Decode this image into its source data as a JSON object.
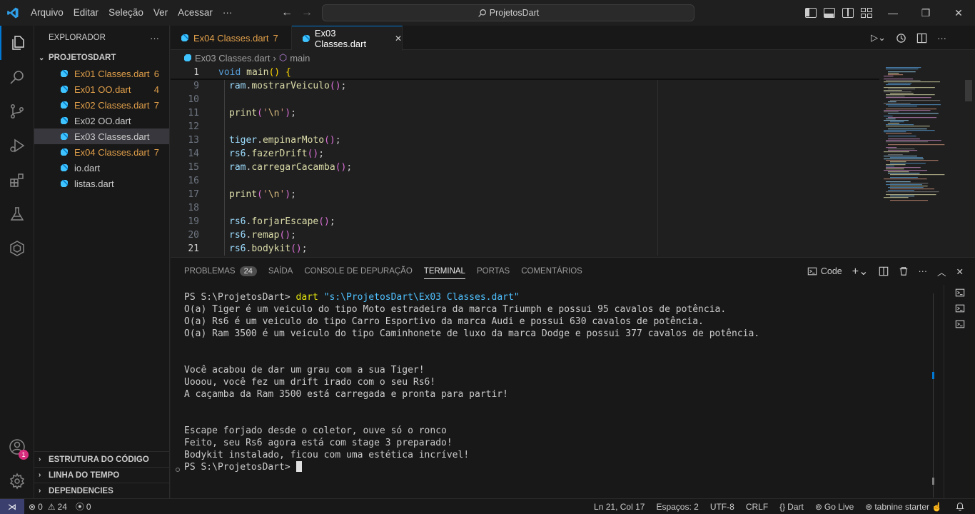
{
  "menu": [
    "Arquivo",
    "Editar",
    "Seleção",
    "Ver",
    "Acessar",
    "···"
  ],
  "command_center": "ProjetosDart",
  "sidebar": {
    "title": "EXPLORADOR",
    "more": "···",
    "project": "PROJETOSDART",
    "files": [
      {
        "name": "Ex01 Classes.dart",
        "count": "6",
        "modified": true
      },
      {
        "name": "Ex01 OO.dart",
        "count": "4",
        "modified": true
      },
      {
        "name": "Ex02 Classes.dart",
        "count": "7",
        "modified": true
      },
      {
        "name": "Ex02 OO.dart",
        "count": "",
        "modified": false
      },
      {
        "name": "Ex03 Classes.dart",
        "count": "",
        "modified": false,
        "selected": true
      },
      {
        "name": "Ex04 Classes.dart",
        "count": "7",
        "modified": true
      },
      {
        "name": "io.dart",
        "count": "",
        "modified": false
      },
      {
        "name": "listas.dart",
        "count": "",
        "modified": false
      }
    ],
    "bottom_sections": [
      "ESTRUTURA DO CÓDIGO",
      "LINHA DO TEMPO",
      "DEPENDENCIES"
    ]
  },
  "tabs": [
    {
      "label": "Ex04 Classes.dart",
      "badge": "7"
    },
    {
      "label": "Ex03 Classes.dart",
      "close": "✕"
    }
  ],
  "breadcrumb": {
    "file": "Ex03 Classes.dart",
    "symbol": "main"
  },
  "editor": {
    "sticky": {
      "ln": "1",
      "code": "void main() {"
    },
    "lines": [
      {
        "ln": "9",
        "code": "ram.mostrarVeiculo();"
      },
      {
        "ln": "10",
        "code": ""
      },
      {
        "ln": "11",
        "code": "print('\\n');"
      },
      {
        "ln": "12",
        "code": ""
      },
      {
        "ln": "13",
        "code": "tiger.empinarMoto();"
      },
      {
        "ln": "14",
        "code": "rs6.fazerDrift();"
      },
      {
        "ln": "15",
        "code": "ram.carregarCacamba();"
      },
      {
        "ln": "16",
        "code": ""
      },
      {
        "ln": "17",
        "code": "print('\\n');"
      },
      {
        "ln": "18",
        "code": ""
      },
      {
        "ln": "19",
        "code": "rs6.forjarEscape();"
      },
      {
        "ln": "20",
        "code": "rs6.remap();"
      },
      {
        "ln": "21",
        "code": "rs6.bodykit();"
      }
    ]
  },
  "panel": {
    "tabs": [
      "PROBLEMAS",
      "SAÍDA",
      "CONSOLE DE DEPURAÇÃO",
      "TERMINAL",
      "PORTAS",
      "COMENTÁRIOS"
    ],
    "problems_count": "24",
    "active_tab": "TERMINAL",
    "shell_label": "Code",
    "terminal": {
      "prompt": "PS S:\\ProjetosDart> ",
      "command": "dart",
      "arg": "\"s:\\ProjetosDart\\Ex03 Classes.dart\"",
      "output": [
        "O(a) Tiger é um veiculo do tipo Moto estradeira da marca Triumph e possui 95 cavalos de potência.",
        "O(a) Rs6 é um veiculo do tipo Carro Esportivo da marca Audi e possui 630 cavalos de potência.",
        "O(a) Ram 3500 é um veiculo do tipo Caminhonete de luxo da marca Dodge e possui 377 cavalos de potência.",
        "",
        "",
        "Você acabou de dar um grau com a sua Tiger!",
        "Uooou, você fez um drift irado com o seu Rs6!",
        "A caçamba da Ram 3500 está carregada e pronta para partir!",
        "",
        "",
        "Escape forjado desde o coletor, ouve só o ronco",
        "Feito, seu Rs6 agora está com stage 3 preparado!",
        "Bodykit instalado, ficou com uma estética incrível!"
      ],
      "final_prompt": "PS S:\\ProjetosDart> "
    }
  },
  "statusbar": {
    "errors": "0",
    "warnings": "24",
    "ports": "0",
    "position": "Ln 21, Col 17",
    "spaces": "Espaços: 2",
    "encoding": "UTF-8",
    "eol": "CRLF",
    "language": "Dart",
    "golive": "Go Live",
    "tabnine": "tabnine starter",
    "accounts_badge": "1"
  }
}
